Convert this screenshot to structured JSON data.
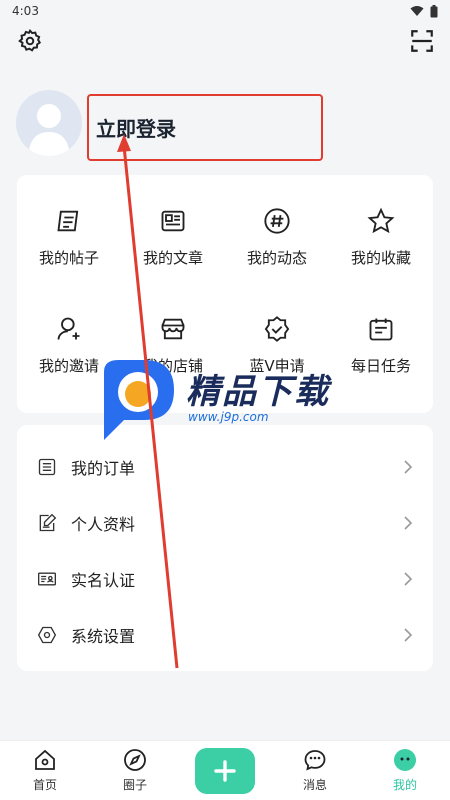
{
  "status": {
    "time": "4:03"
  },
  "profile": {
    "login_label": "立即登录"
  },
  "grid": [
    {
      "label": "我的帖子",
      "icon": "post-icon"
    },
    {
      "label": "我的文章",
      "icon": "article-icon"
    },
    {
      "label": "我的动态",
      "icon": "hashtag-icon"
    },
    {
      "label": "我的收藏",
      "icon": "star-icon"
    },
    {
      "label": "我的邀请",
      "icon": "invite-user-icon"
    },
    {
      "label": "我的店铺",
      "icon": "store-icon"
    },
    {
      "label": "蓝V申请",
      "icon": "verified-badge-icon"
    },
    {
      "label": "每日任务",
      "icon": "calendar-task-icon"
    }
  ],
  "menu": [
    {
      "label": "我的订单",
      "icon": "order-list-icon"
    },
    {
      "label": "个人资料",
      "icon": "edit-profile-icon"
    },
    {
      "label": "实名认证",
      "icon": "id-card-icon"
    },
    {
      "label": "系统设置",
      "icon": "settings-hex-icon"
    }
  ],
  "watermark": {
    "title": "精品下载",
    "url": "www.j9p.com"
  },
  "nav": [
    {
      "label": "首页",
      "icon": "home-icon"
    },
    {
      "label": "圈子",
      "icon": "compass-icon"
    },
    {
      "label": "消息",
      "icon": "message-icon"
    },
    {
      "label": "我的",
      "icon": "profile-face-icon"
    }
  ],
  "colors": {
    "accent": "#3ccfa5",
    "annotation": "#e03c30",
    "active_nav": "#2ec4a4"
  }
}
